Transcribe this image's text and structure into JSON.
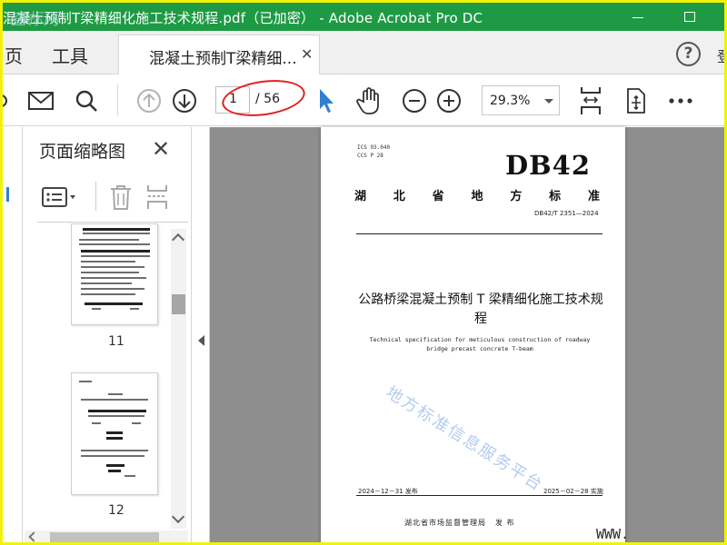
{
  "window": {
    "title": "混凝土预制T梁精细化施工技术规程.pdf（已加密） - Adobe Acrobat Pro DC",
    "watermark": "查标网"
  },
  "menu": {
    "home": "页",
    "tools": "工具",
    "doc_tab": "混凝土预制T梁精细...",
    "help": "?",
    "signin": "登"
  },
  "toolbar": {
    "page_current": "1",
    "page_total": "/ 56",
    "zoom": "29.3%"
  },
  "thumbnails": {
    "title": "页面缩略图",
    "pages": [
      {
        "number": "11"
      },
      {
        "number": "12"
      }
    ]
  },
  "document": {
    "ics": "ICS 93.040",
    "ccs": "CCS P 28",
    "db_code": "DB42",
    "standard_label": [
      "湖",
      "北",
      "省",
      "地",
      "方",
      "标",
      "准"
    ],
    "standard_number": "DB42/T 2351—2024",
    "title_cn": "公路桥梁混凝土预制 T 梁精细化施工技术规程",
    "title_en_1": "Technical specification for meticulous construction of roadway",
    "title_en_2": "bridge precast concrete T-beam",
    "watermark": "地方标准信息服务平台",
    "publish_date": "2024－12－31 发布",
    "implement_date": "2025－02－28 实施",
    "issuer": "湖北省市场监督管理局",
    "issuer_suffix": "发 布"
  },
  "footer": {
    "www": "WWW."
  },
  "colors": {
    "titlebar": "#1e9a44",
    "frame": "#f2f209",
    "viewer_bg": "#8e8e8e",
    "highlight_oval": "#e0201e",
    "select_cursor": "#2f80d1"
  }
}
